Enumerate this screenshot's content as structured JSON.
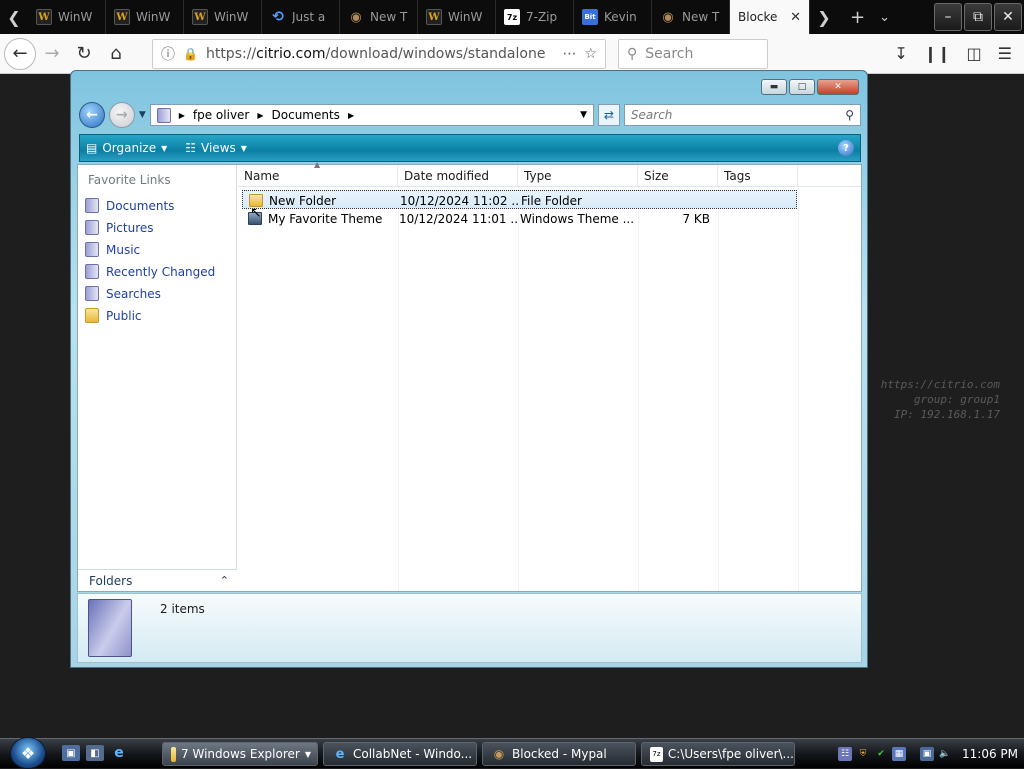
{
  "browser": {
    "tabs": [
      {
        "label": "WinW",
        "icon": "w-logo-icon",
        "active": false
      },
      {
        "label": "WinW",
        "icon": "w-logo-icon",
        "active": false
      },
      {
        "label": "WinW",
        "icon": "w-logo-icon",
        "active": false
      },
      {
        "label": "Just a",
        "icon": "spinner-icon",
        "active": false
      },
      {
        "label": "New T",
        "icon": "eye-icon",
        "active": false
      },
      {
        "label": "WinW",
        "icon": "w-logo-icon",
        "active": false
      },
      {
        "label": "7-Zip",
        "icon": "7zip-icon",
        "active": false
      },
      {
        "label": "Kevin",
        "icon": "bitly-icon",
        "active": false
      },
      {
        "label": "New T",
        "icon": "eye-icon",
        "active": false
      },
      {
        "label": "Blocke",
        "icon": "",
        "active": true
      }
    ],
    "fav_text": {
      "w": "W",
      "zip": "7z",
      "bit": "Bit"
    },
    "url_prefix": "https://",
    "url_host": "citrio.com",
    "url_path": "/download/windows/standalone",
    "search_placeholder": "Search"
  },
  "explorer": {
    "breadcrumb": [
      "fpe oliver",
      "Documents"
    ],
    "search_placeholder": "Search",
    "toolbar": {
      "organize": "Organize",
      "views": "Views",
      "help": "?"
    },
    "favorite_links_title": "Favorite Links",
    "favorite_links": [
      "Documents",
      "Pictures",
      "Music",
      "Recently Changed",
      "Searches",
      "Public"
    ],
    "folders_label": "Folders",
    "columns": [
      "Name",
      "Date modified",
      "Type",
      "Size",
      "Tags"
    ],
    "rows": [
      {
        "name": "New Folder",
        "date": "10/12/2024 11:02 ...",
        "type": "File Folder",
        "size": "",
        "icon": "folder-icon",
        "selected": true
      },
      {
        "name": "My Favorite Theme",
        "date": "10/12/2024 11:01 ...",
        "type": "Windows Theme ...",
        "size": "7 KB",
        "icon": "theme-file-icon",
        "selected": false
      }
    ],
    "details": {
      "count": "2 items"
    }
  },
  "watermark": [
    "https://citrio.com",
    "group: group1",
    "IP: 192.168.1.17"
  ],
  "taskbar": {
    "tasks": [
      {
        "label": "7 Windows Explorer",
        "icon": "folder-icon",
        "active": true
      },
      {
        "label": "CollabNet - Windo...",
        "icon": "ie-icon",
        "active": false
      },
      {
        "label": "Blocked - Mypal",
        "icon": "mypal-icon",
        "active": false
      },
      {
        "label": "C:\\Users\\fpe oliver\\...",
        "icon": "7zip-icon",
        "active": false
      }
    ],
    "clock": "11:06 PM"
  },
  "colors": {
    "explorer_toolbar": "#0b7fa4",
    "link_blue": "#1f3fa6",
    "taskbar": "#15181c",
    "url_lock_green": "#17a52e"
  }
}
